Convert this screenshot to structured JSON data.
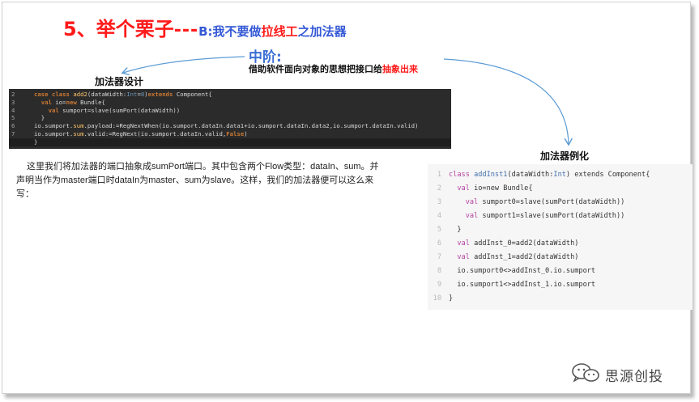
{
  "title": {
    "main": "5、举个栗子",
    "dash": "---",
    "sub_b": "B:",
    "sub_pre": "我不要做",
    "sub_hl": "拉线工",
    "sub_post": "之加法器"
  },
  "middle": {
    "title": "中阶:",
    "desc_pre": "借助软件面向对象的思想把接口给",
    "desc_hl": "抽象出来"
  },
  "labels": {
    "design": "加法器设计",
    "instance": "加法器例化"
  },
  "code_dark": {
    "line_numbers": [
      "2",
      "3",
      "4",
      "5",
      "6",
      "7",
      "8"
    ]
  },
  "paragraph": "这里我们将加法器的端口抽象成sumPort端口。其中包含两个Flow类型：dataIn、sum。并声明当作为master端口时dataIn为master、sum为slave。这样，我们的加法器便可以这么来写：",
  "code_light": {
    "line_numbers": [
      "1",
      "2",
      "3",
      "4",
      "5",
      "6",
      "7",
      "8",
      "9",
      "10"
    ]
  },
  "logo": {
    "icon": "wechat-icon",
    "name": "思源创投"
  },
  "colors": {
    "title_red": "#ff1a1a",
    "mid_blue": "#3b6fd4",
    "arrow_blue": "#5b9bd5",
    "code_dark_bg": "#2b2b2b",
    "code_light_bg": "#f6f6f6"
  }
}
